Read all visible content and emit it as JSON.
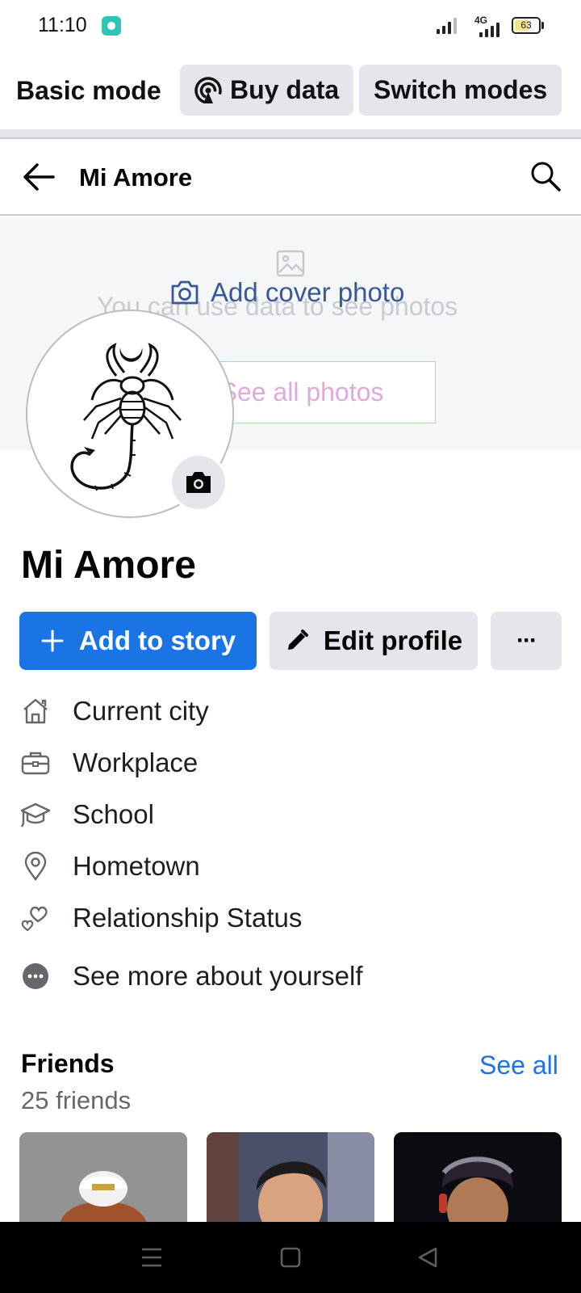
{
  "status_bar": {
    "time": "11:10",
    "network": "4G",
    "battery": "63"
  },
  "mode_bar": {
    "title": "Basic mode",
    "buy_data_label": "Buy data",
    "switch_modes_label": "Switch modes"
  },
  "header": {
    "title": "Mi Amore"
  },
  "cover": {
    "hint_text": "You can use data to see photos",
    "see_photos_label": "See all photos",
    "add_cover_label": "Add cover photo"
  },
  "profile": {
    "name": "Mi Amore",
    "add_story_label": "Add to story",
    "edit_profile_label": "Edit profile",
    "more_label": "···"
  },
  "details": [
    {
      "icon": "home-icon",
      "label": "Current city"
    },
    {
      "icon": "briefcase-icon",
      "label": "Workplace"
    },
    {
      "icon": "graduation-cap-icon",
      "label": "School"
    },
    {
      "icon": "location-pin-icon",
      "label": "Hometown"
    },
    {
      "icon": "hearts-icon",
      "label": "Relationship Status"
    },
    {
      "icon": "more-circle-icon",
      "label": "See more about yourself"
    }
  ],
  "friends": {
    "title": "Friends",
    "count_text": "25 friends",
    "see_all_label": "See all"
  },
  "colors": {
    "brand_blue": "#1b74e4",
    "link_blue": "#385898",
    "secondary_bg": "#e4e6eb"
  }
}
